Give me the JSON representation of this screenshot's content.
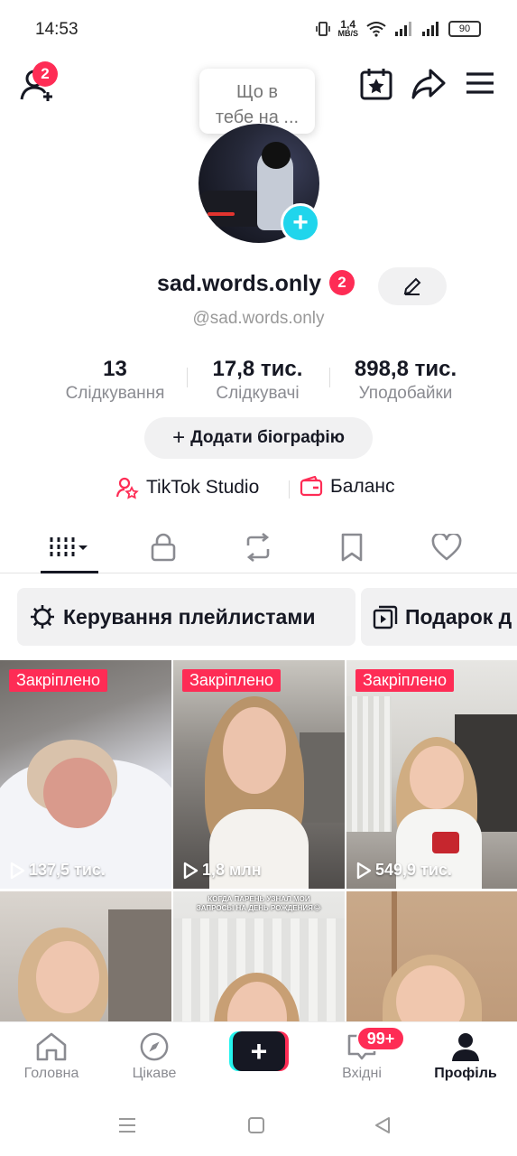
{
  "status_bar": {
    "time": "14:53",
    "net_speed_value": "1,4",
    "net_speed_unit": "MB/S",
    "battery": "90"
  },
  "header": {
    "add_friend_badge": "2",
    "tooltip_line1": "Що в",
    "tooltip_line2": "тебе на ..."
  },
  "profile": {
    "username": "sad.words.only",
    "username_badge": "2",
    "handle": "@sad.words.only"
  },
  "stats": [
    {
      "value": "13",
      "label": "Слідкування"
    },
    {
      "value": "17,8 тис.",
      "label": "Слідкувачі"
    },
    {
      "value": "898,8 тис.",
      "label": "Уподобайки"
    }
  ],
  "bio_button": "Додати біографію",
  "links": {
    "studio": "TikTok Studio",
    "balance": "Баланс"
  },
  "chips": {
    "playlists": "Керування плейлистами",
    "gift": "Подарок д"
  },
  "videos": [
    {
      "pinned": "Закріплено",
      "views": "137,5 тис."
    },
    {
      "pinned": "Закріплено",
      "views": "1,8 млн"
    },
    {
      "pinned": "Закріплено",
      "views": "549,9 тис."
    },
    {
      "overlay_line1": "КОГДА ПАРЕНЬ УЗНАЛ МОИ",
      "overlay_line2": "ЗАПРОСЫ НА ДЕНЬ РОЖДЕНИЯ😂"
    }
  ],
  "bottom_nav": {
    "home": "Головна",
    "discover": "Цікаве",
    "create": "+",
    "inbox": "Вхідні",
    "inbox_badge": "99+",
    "profile": "Профіль"
  },
  "colors": {
    "accent_red": "#fe2c55",
    "accent_cyan": "#25f4ee",
    "text_primary": "#161823",
    "text_secondary": "#8a8b91"
  }
}
